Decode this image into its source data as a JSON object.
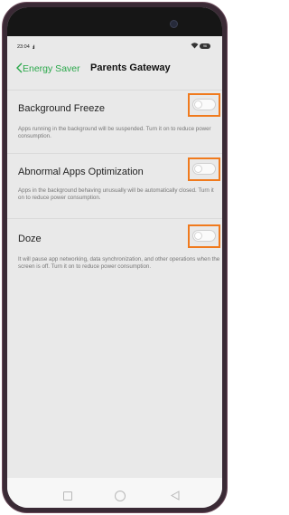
{
  "status": {
    "time": "23:04",
    "signal": "᎓ıl",
    "battery": "96"
  },
  "nav": {
    "back_label": "Energy Saver",
    "title": "Parents Gateway"
  },
  "settings": [
    {
      "label": "Background Freeze",
      "description": "Apps running in the background will be suspended. Turn it on to reduce power consumption.",
      "enabled": false
    },
    {
      "label": "Abnormal Apps Optimization",
      "description": "Apps in the background behaving unusually will be automatically closed. Turn it on to reduce power consumption.",
      "enabled": false
    },
    {
      "label": "Doze",
      "description": "It will pause app networking, data synchronization, and other operations when the screen is off. Turn it on to reduce power consumption.",
      "enabled": false
    }
  ],
  "colors": {
    "accent": "#2aa84a",
    "highlight": "#f07a1d",
    "background": "#e9e9e9"
  }
}
